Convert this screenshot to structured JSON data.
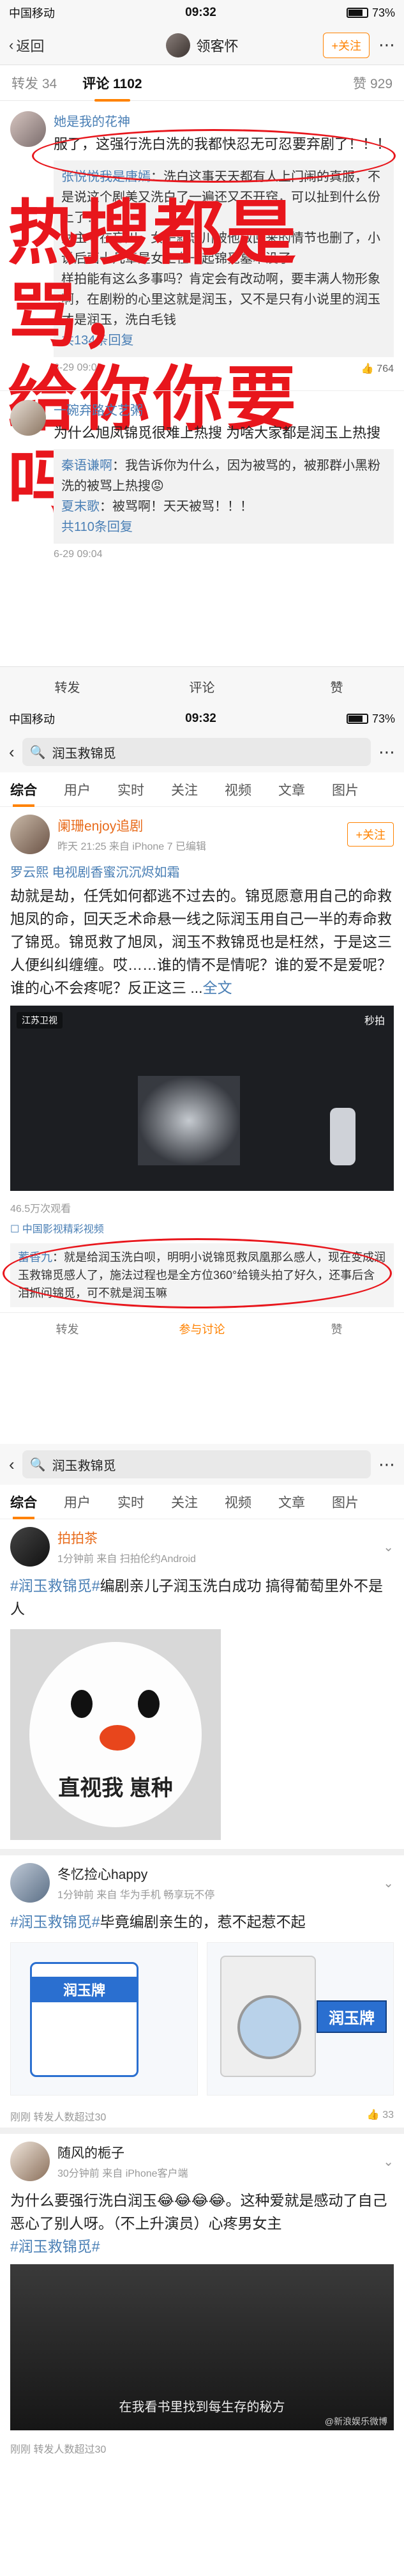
{
  "s1": {
    "status": {
      "carrier": "中国移动",
      "wifi": "WiFi",
      "time": "09:32",
      "battery": "73%"
    },
    "nav": {
      "back": "返回",
      "user": "领客怀",
      "follow": "+关注"
    },
    "tabs": {
      "repost": "转发 34",
      "comment": "评论 1102",
      "like": "赞 929"
    },
    "overlay": {
      "line1": "热搜都是骂，",
      "line2": "给你你要吗？"
    },
    "comment1": {
      "name": "她是我的花神",
      "text": "服了，这强行洗白洗的我都快忍无可忍要弃剧了！！！",
      "replies": [
        {
          "name": "张悦悦我是唐嫣",
          "text": "：洗白这事天天都有人上门闹的真服，不是说这个剧美又洗白了一遍还又不开窍，可以扯到什么份上了？"
        },
        {
          "name": "",
          "text": "女主守在忘川，女子就忘川被他救回来的情节也删了，小说后面十几章是女主在一起锦觅墓本没了"
        },
        {
          "name": "",
          "text": "样拍能有这么多事吗？肯定会有改动啊，要丰满人物形象啊，在剧粉的心里这就是润玉，又不是只有小说里的润玉才是润玉，洗白毛钱"
        }
      ],
      "more": "共134条回复",
      "time": "6-29 09:04",
      "likes": "764"
    },
    "comment2": {
      "name": "一碗弃路文艺粥",
      "text": "为什么旭凤锦觅很难上热搜 为啥大家都是润玉上热搜",
      "replies": [
        {
          "name": "秦语谦啊",
          "text": "：我告诉你为什么，因为被骂的，被那群小黑粉洗的被骂上热搜😡"
        },
        {
          "name": "夏末歌",
          "text": "：被骂啊！天天被骂！！！"
        }
      ],
      "more": "共110条回复",
      "time": "6-29 09:04"
    },
    "bottom": {
      "repost": "转发",
      "comment": "评论",
      "like": "赞"
    }
  },
  "s2": {
    "status": {
      "carrier": "中国移动",
      "wifi": "WiFi",
      "time": "09:32",
      "battery": "73%"
    },
    "search": "润玉救锦觅",
    "tabs": [
      "综合",
      "用户",
      "实时",
      "关注",
      "视频",
      "文章",
      "图片"
    ],
    "post": {
      "name": "阑珊enjoy追剧",
      "sub": "昨天 21:25 来自 iPhone 7 已编辑",
      "follow": "+关注",
      "tags": "罗云熙   电视剧香蜜沉沉烬如霜",
      "text": "劫就是劫，任凭如何都逃不过去的。锦觅愿意用自己的命救旭凤的命，回天乏术命悬一线之际润玉用自己一半的寿命救了锦觅。锦觅救了旭凤，润玉不救锦觅也是枉然，于是这三人便纠纠缠缠。哎……谁的情不是情呢？谁的爱不是爱呢？谁的心不会疼呢？反正这三 ...",
      "fulltext": "全文",
      "video_left": "江苏卫视",
      "video_right": "秒拍",
      "views": "46.5万次观看",
      "source": "☐ 中国影视精彩视频",
      "hot": {
        "name": "蓄香九",
        "text": "：就是给润玉洗白呗，明明小说锦觅救凤凰那么感人，现在变成润玉救锦觅感人了，施法过程也是全方位360°给镜头拍了好久，还事后含泪抓问锦觅，可不就是润玉嘛"
      },
      "actions": [
        "转发",
        "参与讨论",
        "赞"
      ]
    }
  },
  "s3": {
    "search": "润玉救锦觅",
    "tabs": [
      "综合",
      "用户",
      "实时",
      "关注",
      "视频",
      "文章",
      "图片"
    ],
    "post1": {
      "name": "拍拍茶",
      "sub": "1分钟前 来自 扫拍伦约Android",
      "text_topic": "#润玉救锦觅#",
      "text": "编剧亲儿子润玉洗白成功 搞得葡萄里外不是人",
      "caption": "直视我 崽种"
    },
    "post2": {
      "name": "冬忆捡心happy",
      "sub": "1分钟前 来自 华为手机 畅享玩不停",
      "text_topic": "#润玉救锦觅#",
      "text": "毕竟编剧亲生的，惹不起惹不起",
      "pack_label": "润玉牌",
      "washer_label": "润玉牌",
      "foot": "刚刚  转发人数超过30",
      "likes": "33"
    },
    "post3": {
      "name": "随风的栀子",
      "sub": "30分钟前 来自 iPhone客户端",
      "text": "为什么要强行洗白润玉😂😂😂😂。这种爱就是感动了自己恶心了别人呀。（不上升演员）心疼男女主",
      "text_topic": "#润玉救锦觅#",
      "caption": "在我看书里找到每生存的秘方",
      "watermark": "@新浪娱乐微博",
      "foot": "刚刚  转发人数超过30"
    }
  }
}
